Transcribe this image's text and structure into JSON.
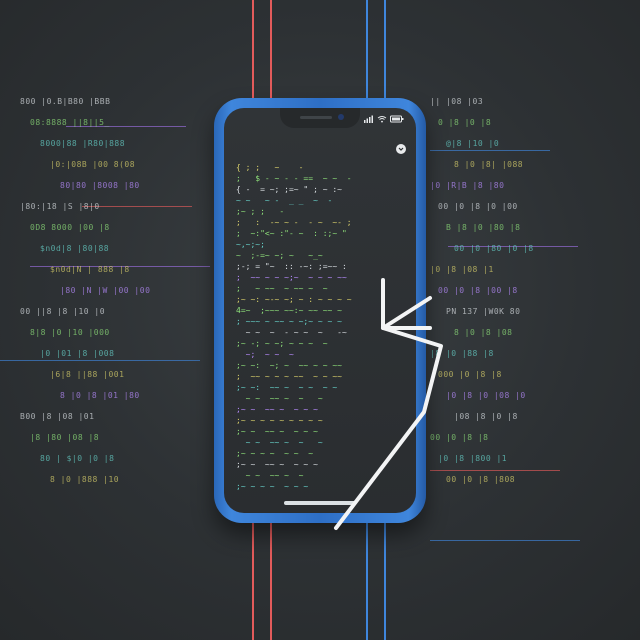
{
  "background": {
    "colors": {
      "base": "#2f3336",
      "red_line": "#e25b5b",
      "blue_line": "#3f86dc",
      "purple_line": "#9b6fe0",
      "green_code": "#8ee07a",
      "teal_code": "#66d0c8",
      "yellow_code": "#d8cf6b",
      "purple_code": "#b88cff",
      "white_code": "#d8dde1"
    },
    "left_code": [
      "800 |0.B|B80 |BBB",
      "08:8888 ||8||5_",
      "8000|88 |R80|888",
      "|0:|08B |00 8(08",
      "80|80 |8008 |80",
      "|80:|18 |S |8|0",
      "0D8 8000 |00 |8",
      "$n0d|8 |80|88",
      "$n0d|N | 888 |8",
      "|80 |N |W |00 |00",
      "00 ||8 |8 |10 |0",
      "8|8 |0 |10 |000",
      "|0 |01 |8 |008",
      "|6|8 ||88 |001",
      "8 |0 |8 |01 |80",
      "B00 |8 |08 |01",
      "|8 |80 |08 |8",
      "80 | $|0 |0 |8",
      "8 |0 |888 |10"
    ],
    "right_code": [
      "|| |08 |03",
      "0 |8 |0 |8",
      "@|8 |10 |0",
      "8 |0 |8| |088",
      "|0 |R|B |8 |80",
      "00 |0 |8 |0 |00",
      "B |8 |0 |80 |8",
      "00 |0 |80 |0 |8",
      "|0 |8 |08 |1",
      "00 |0 |8 |00 |8",
      "PN 137 |W0K 80",
      "8 |0 |8 |08",
      "|8 |0 |88 |8",
      "000 |0 |8 |8",
      "|0 |8 |0 |08 |0",
      "|08 |8 |0 |8",
      "00 |0 |8 |8",
      "|0 |8 |800 |1",
      "00 |0 |8 |808"
    ]
  },
  "phone": {
    "status": {
      "signal_icon": "signal-icon",
      "wifi_icon": "wifi-icon",
      "battery_icon": "battery-icon"
    },
    "badge_icon": "chevron-down-icon",
    "code_lines": [
      {
        "text": "{ ; ;   ~    -",
        "color": "#d8cf6b"
      },
      {
        "text": ";   $ - ~ - - ==  ~ ~  -",
        "color": "#8ee07a"
      },
      {
        "text": "{ -  = ~; ;=~ \" ; ~ :~",
        "color": "#d8dde1"
      },
      {
        "text": "~ ~   ~ -  _ _  ~  -",
        "color": "#66d0c8"
      },
      {
        "text": ";~ ; ;   -",
        "color": "#8ee07a"
      },
      {
        "text": ";   :  -~ ~ -  - ~  ~- ;",
        "color": "#d8cf6b"
      },
      {
        "text": ";  ~:\"<~ :\"- ~  : :;~ \"",
        "color": "#8ee07a"
      },
      {
        "text": "~,~;~;",
        "color": "#66d0c8"
      },
      {
        "text": "~  ;-=~ ~; ~   ~_~",
        "color": "#8ee07a"
      },
      {
        "text": ";-; = \"~  :: -~: ;=~~ :",
        "color": "#d8dde1"
      },
      {
        "text": ";  ~~ ~ ~ ~;~  ~ ~ ~ ~~",
        "color": "#b88cff"
      },
      {
        "text": ";   ~ ~~  ~ ~~ ~  ~",
        "color": "#8ee07a"
      },
      {
        "text": ";~ ~: ~-~ ~; ~ : ~ ~ ~ ~",
        "color": "#d8cf6b"
      },
      {
        "text": "4=~  ;~~~ ~~:~ ~~ ~~ ~",
        "color": "#8ee07a"
      },
      {
        "text": "; ~~~ ~ ~~ ~ ~;~ ~ ~ ~",
        "color": "#66d0c8"
      },
      {
        "text": "  ~ ~  ~  - ~ ~  ~   -~",
        "color": "#d8dde1"
      },
      {
        "text": ";~ -; ~ ~; ~ ~ ~  ~",
        "color": "#8ee07a"
      },
      {
        "text": "  ~;  ~ ~  ~",
        "color": "#b88cff"
      },
      {
        "text": ";~ ~:  ~; ~  ~~ ~ ~ ~~",
        "color": "#8ee07a"
      },
      {
        "text": ";  ~~ ~ ~ ~ ~~  ~ ~ ~~",
        "color": "#d8cf6b"
      },
      {
        "text": ";~ ~:  ~~ ~  ~ ~  ~ ~",
        "color": "#66d0c8"
      },
      {
        "text": "  ~ ~  ~~ ~  ~   ~",
        "color": "#8ee07a"
      },
      {
        "text": ";~ ~  ~~ ~  ~ ~ ~",
        "color": "#b88cff"
      },
      {
        "text": ";~ ~ ~ ~ ~ ~ ~ ~ ~",
        "color": "#d8cf6b"
      },
      {
        "text": ";~ ~  ~~ ~  ~ ~ ~",
        "color": "#8ee07a"
      },
      {
        "text": "  ~ ~  ~~ ~  ~   ~",
        "color": "#66d0c8"
      },
      {
        "text": ";~ ~ ~ ~  ~ ~  ~",
        "color": "#8ee07a"
      },
      {
        "text": ";~ ~  ~~ ~  ~ ~ ~",
        "color": "#d8dde1"
      },
      {
        "text": "  ~ ~  ~~ ~  ~",
        "color": "#8ee07a"
      },
      {
        "text": ";~ ~ ~ ~  ~ ~ ~",
        "color": "#66d0c8"
      }
    ]
  }
}
